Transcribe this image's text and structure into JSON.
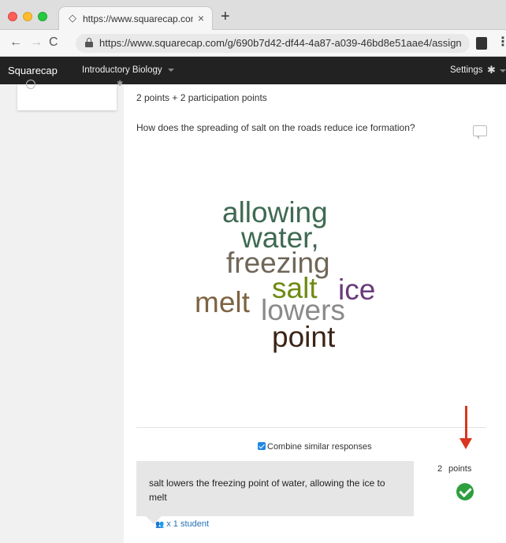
{
  "browser": {
    "tab_title": "https://www.squarecap.com/g/",
    "tab_close": "×",
    "new_tab": "+",
    "url": "https://www.squarecap.com/g/690b7d42-df44-4a87-a039-46bd8e51aae4/assign...",
    "back_icon": "←",
    "forward_icon": "→",
    "reload_icon": "C",
    "menu_icon": "⋮"
  },
  "navbar": {
    "brand": "Squarecap",
    "course": "Introductory Biology",
    "settings": "Settings",
    "gear_glyph": "✱"
  },
  "question": {
    "points": "2 points + 2 participation points",
    "text": "How does the spreading of salt on the roads reduce ice formation?"
  },
  "wordcloud": {
    "words": {
      "allowing": "allowing",
      "water": "water,",
      "freezing": "freezing",
      "salt": "salt",
      "ice": "ice",
      "melt": "melt",
      "lowers": "lowers",
      "point": "point"
    },
    "colors": {
      "allowing": "#3f6a52",
      "water": "#3f6a52",
      "freezing": "#6f6657",
      "salt": "#6e8a12",
      "ice": "#6b3a7c",
      "melt": "#7d6342",
      "lowers": "#8a8a8a",
      "point": "#3b2416"
    }
  },
  "responses": {
    "combine_label": "Combine similar responses",
    "combine_checked": true,
    "items": [
      {
        "text": "salt lowers the freezing point of water, allowing the ice to melt",
        "points_value": "2",
        "points_label": "points",
        "correct": true,
        "student_count": "x 1 student"
      }
    ]
  },
  "colors": {
    "navbar_bg": "#222222",
    "arrow": "#d9361e",
    "correct": "#2e9e3e",
    "link": "#2472b5"
  }
}
